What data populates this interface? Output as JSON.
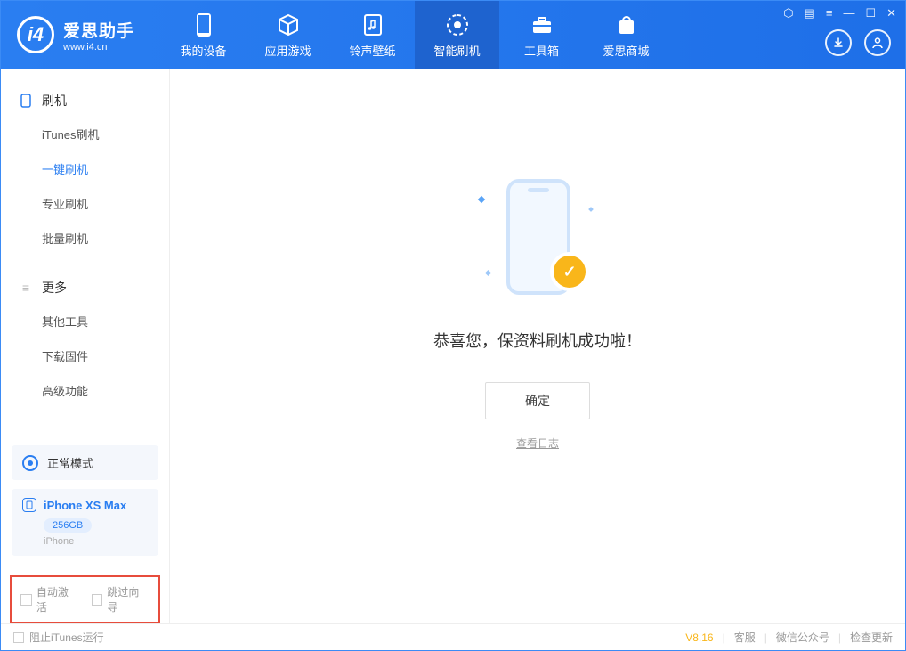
{
  "app": {
    "title": "爱思助手",
    "subtitle": "www.i4.cn"
  },
  "nav": {
    "tabs": [
      {
        "label": "我的设备",
        "icon": "phone"
      },
      {
        "label": "应用游戏",
        "icon": "cube"
      },
      {
        "label": "铃声壁纸",
        "icon": "music"
      },
      {
        "label": "智能刷机",
        "icon": "shield",
        "active": true
      },
      {
        "label": "工具箱",
        "icon": "toolbox"
      },
      {
        "label": "爱思商城",
        "icon": "bag"
      }
    ]
  },
  "sidebar": {
    "section1": {
      "title": "刷机",
      "items": [
        {
          "label": "iTunes刷机"
        },
        {
          "label": "一键刷机",
          "active": true
        },
        {
          "label": "专业刷机"
        },
        {
          "label": "批量刷机"
        }
      ]
    },
    "section2": {
      "title": "更多",
      "items": [
        {
          "label": "其他工具"
        },
        {
          "label": "下载固件"
        },
        {
          "label": "高级功能"
        }
      ]
    },
    "mode": "正常模式",
    "device": {
      "name": "iPhone XS Max",
      "storage": "256GB",
      "type": "iPhone"
    },
    "checks": {
      "auto_activate": "自动激活",
      "skip_guide": "跳过向导"
    }
  },
  "main": {
    "success_message": "恭喜您，保资料刷机成功啦！",
    "ok_button": "确定",
    "view_log": "查看日志"
  },
  "footer": {
    "block_itunes": "阻止iTunes运行",
    "version": "V8.16",
    "links": {
      "service": "客服",
      "wechat": "微信公众号",
      "update": "检查更新"
    }
  }
}
